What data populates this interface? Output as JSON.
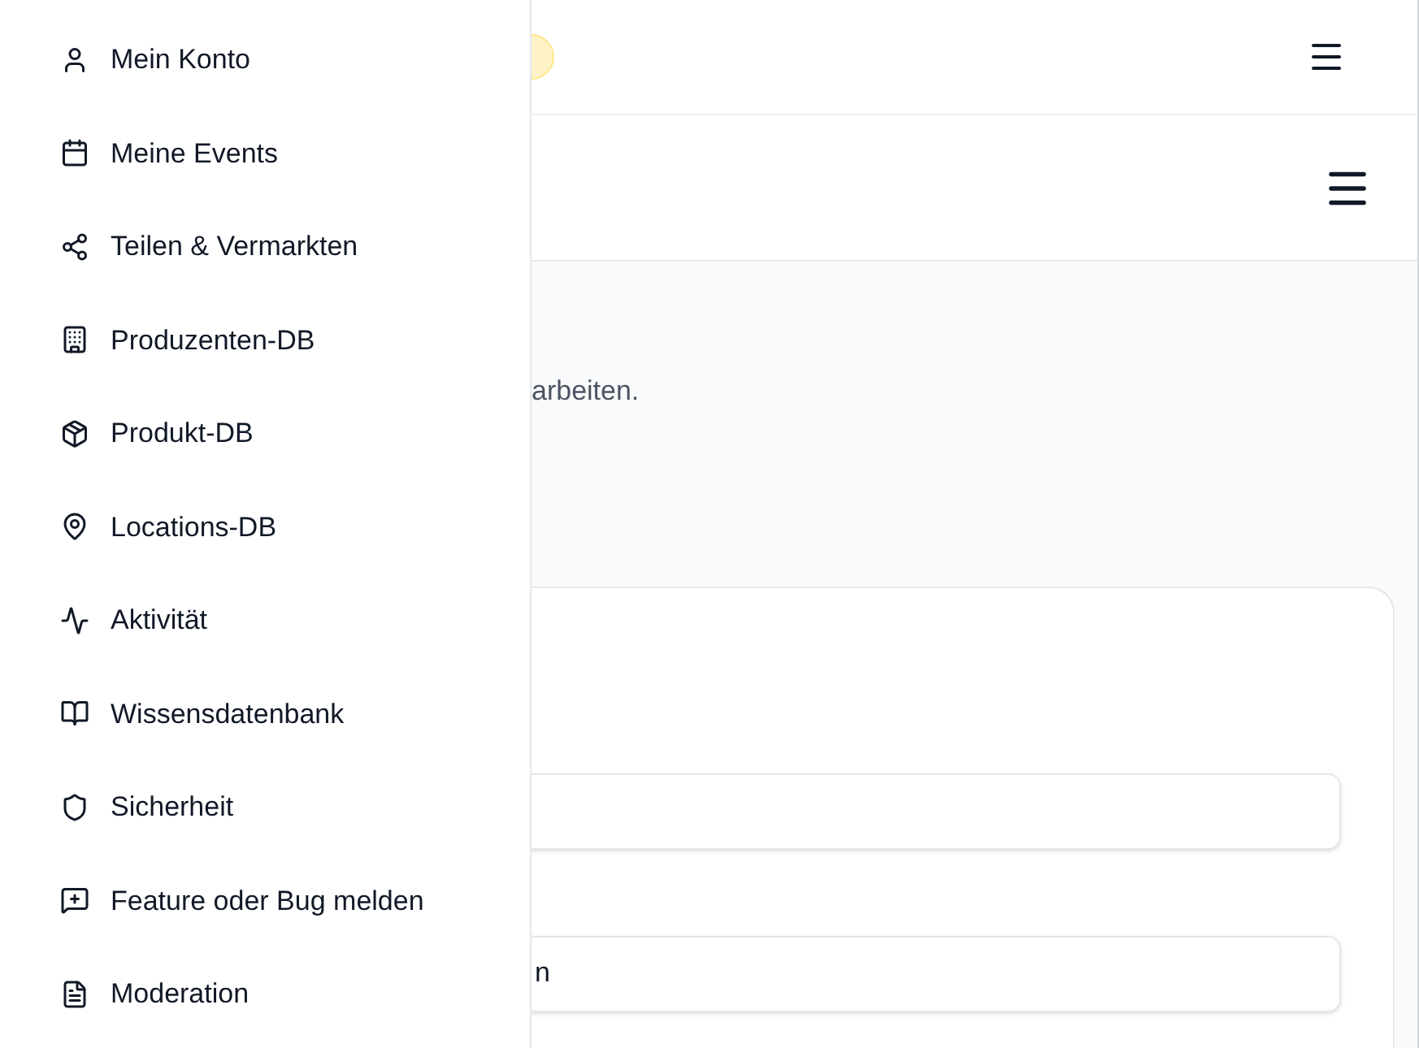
{
  "menu": [
    {
      "kind": "user",
      "label": "Mein Konto"
    },
    {
      "kind": "calendar",
      "label": "Meine Events"
    },
    {
      "kind": "share",
      "label": "Teilen & Vermarkten"
    },
    {
      "kind": "building",
      "label": "Produzenten-DB"
    },
    {
      "kind": "package",
      "label": "Produkt-DB"
    },
    {
      "kind": "pin",
      "label": "Locations-DB"
    },
    {
      "kind": "activity",
      "label": "Aktivität"
    },
    {
      "kind": "book",
      "label": "Wissensdatenbank"
    },
    {
      "kind": "shield",
      "label": "Sicherheit"
    },
    {
      "kind": "feedback",
      "label": "Feature oder Bug melden"
    },
    {
      "kind": "document",
      "label": "Moderation"
    }
  ],
  "page": {
    "description": "arbeiten."
  },
  "form": {
    "fields": [
      {
        "kind": "text"
      },
      {
        "kind": "text",
        "value": "n"
      }
    ]
  }
}
